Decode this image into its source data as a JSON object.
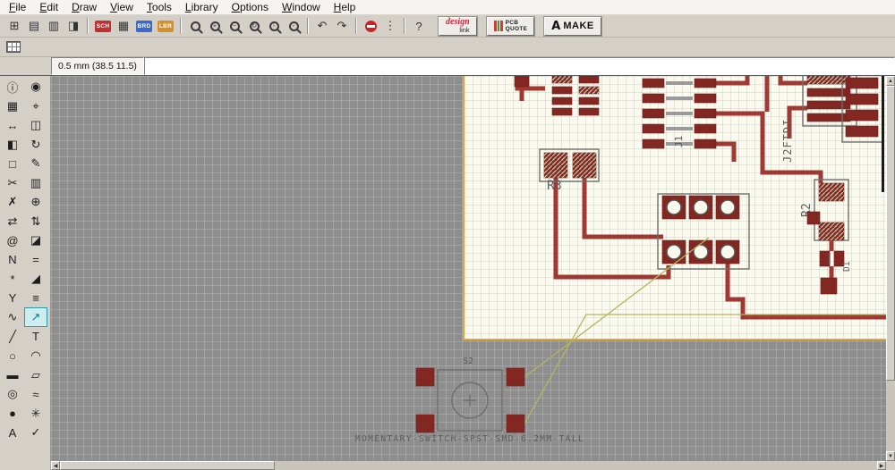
{
  "menubar": {
    "items": [
      "File",
      "Edit",
      "Draw",
      "View",
      "Tools",
      "Library",
      "Options",
      "Window",
      "Help"
    ]
  },
  "toolbar": {
    "buttons": [
      {
        "name": "open-button",
        "type": "glyph",
        "glyph": "⊞"
      },
      {
        "name": "save-button",
        "type": "glyph",
        "glyph": "▤"
      },
      {
        "name": "print-button",
        "type": "glyph",
        "glyph": "▥"
      },
      {
        "name": "cam-processor-button",
        "type": "glyph",
        "glyph": "◨"
      },
      {
        "name": "toolbar-separator",
        "type": "sep"
      },
      {
        "name": "schematic-badge-button",
        "type": "badge",
        "glyph": "SCH",
        "color": "#c03030"
      },
      {
        "name": "grid-badge-button",
        "type": "glyph",
        "glyph": "▦"
      },
      {
        "name": "board-badge-button",
        "type": "badge",
        "glyph": "BRD",
        "color": "#3a6ad0"
      },
      {
        "name": "library-badge-button",
        "type": "badge",
        "glyph": "LBR",
        "color": "#d6902a"
      },
      {
        "name": "toolbar-separator",
        "type": "sep"
      },
      {
        "name": "zoom-fit-button",
        "type": "mag",
        "glyph": ""
      },
      {
        "name": "zoom-in-button",
        "type": "mag",
        "glyph": "+"
      },
      {
        "name": "zoom-out-button",
        "type": "mag",
        "glyph": "−"
      },
      {
        "name": "zoom-redraw-button",
        "type": "mag",
        "glyph": "↻"
      },
      {
        "name": "zoom-select-button",
        "type": "mag",
        "glyph": "▫"
      },
      {
        "name": "zoom-last-button",
        "type": "mag",
        "glyph": "◦"
      },
      {
        "name": "toolbar-separator",
        "type": "sep"
      },
      {
        "name": "undo-button",
        "type": "glyph",
        "glyph": "↶"
      },
      {
        "name": "redo-button",
        "type": "glyph",
        "glyph": "↷"
      },
      {
        "name": "toolbar-separator",
        "type": "sep"
      },
      {
        "name": "stop-button",
        "type": "stop"
      },
      {
        "name": "more-button",
        "type": "glyph",
        "glyph": "⋮"
      },
      {
        "name": "toolbar-separator",
        "type": "sep"
      },
      {
        "name": "help-button",
        "type": "glyph",
        "glyph": "?"
      }
    ],
    "design_link": {
      "line1": "design",
      "line2": "link"
    },
    "pcb_quote": {
      "line1": "PCB",
      "line2": "QUOTE"
    },
    "make": {
      "logo": "A",
      "label": "MAKE"
    }
  },
  "toolbar2": {
    "buttons": [
      {
        "name": "grid-settings-button",
        "type": "grid"
      }
    ]
  },
  "topbar": {
    "coordinates": "0.5 mm (38.5 11.5)",
    "command_value": ""
  },
  "palette": {
    "tools": [
      {
        "name": "info-tool",
        "glyph": "ⓘ"
      },
      {
        "name": "show-tool",
        "glyph": "◉"
      },
      {
        "name": "display-tool",
        "glyph": "▦"
      },
      {
        "name": "mark-tool",
        "glyph": "⌖"
      },
      {
        "name": "move-tool",
        "glyph": "↔"
      },
      {
        "name": "copy-tool",
        "glyph": "◫"
      },
      {
        "name": "mirror-tool",
        "glyph": "◧"
      },
      {
        "name": "rotate-tool",
        "glyph": "↻"
      },
      {
        "name": "group-tool",
        "glyph": "□"
      },
      {
        "name": "change-tool",
        "glyph": "✎"
      },
      {
        "name": "cut-tool",
        "glyph": "✂"
      },
      {
        "name": "paste-tool",
        "glyph": "▥"
      },
      {
        "name": "delete-tool",
        "glyph": "✗"
      },
      {
        "name": "add-tool",
        "glyph": "⊕"
      },
      {
        "name": "pinswap-tool",
        "glyph": "⇄"
      },
      {
        "name": "replace-tool",
        "glyph": "⇅"
      },
      {
        "name": "attribute-tool",
        "glyph": "@"
      },
      {
        "name": "lock-tool",
        "glyph": "◪"
      },
      {
        "name": "name-tool",
        "glyph": "N"
      },
      {
        "name": "value-tool",
        "glyph": "="
      },
      {
        "name": "smash-tool",
        "glyph": "*"
      },
      {
        "name": "miter-tool",
        "glyph": "◢"
      },
      {
        "name": "split-tool",
        "glyph": "Y"
      },
      {
        "name": "optimize-tool",
        "glyph": "≡"
      },
      {
        "name": "route-tool",
        "glyph": "∿"
      },
      {
        "name": "ripup-tool",
        "glyph": "↗",
        "selected": true
      },
      {
        "name": "wire-tool",
        "glyph": "╱"
      },
      {
        "name": "text-tool",
        "glyph": "T"
      },
      {
        "name": "circle-tool",
        "glyph": "○"
      },
      {
        "name": "arc-tool",
        "glyph": "◠"
      },
      {
        "name": "rect-tool",
        "glyph": "▬"
      },
      {
        "name": "polygon-tool",
        "glyph": "▱"
      },
      {
        "name": "via-tool",
        "glyph": "◎"
      },
      {
        "name": "signal-tool",
        "glyph": "≈"
      },
      {
        "name": "hole-tool",
        "glyph": "●"
      },
      {
        "name": "ratsnest-tool",
        "glyph": "✳"
      },
      {
        "name": "auto-route-tool",
        "glyph": "A"
      },
      {
        "name": "drc-tool",
        "glyph": "✓"
      }
    ]
  },
  "board": {
    "labels": {
      "r3": "R3",
      "r2": "R2",
      "d1": "D1",
      "j2": "J2FTDI",
      "j1": "J1"
    },
    "colors": {
      "copper_trace": "#9e3a33",
      "pad": "#822722",
      "board_bg": "#fbfaef",
      "board_outline": "#d8a93f",
      "airwire": "#b5b55e",
      "canvas_bg": "#8e8e8e"
    }
  },
  "footprint": {
    "refdes": "S2",
    "description": "MOMENTARY-SWITCH-SPST-SMD-6.2MM-TALL"
  },
  "scrollbars": {
    "left_arrow": "◀",
    "right_arrow": "▶",
    "up_arrow": "▲",
    "down_arrow": "▼"
  }
}
